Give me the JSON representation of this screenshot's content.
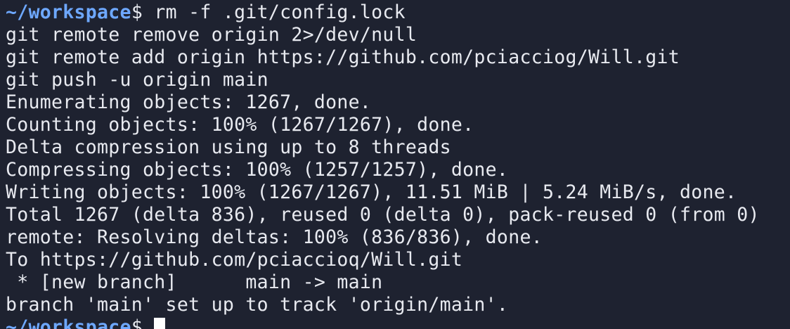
{
  "window": {
    "app": "terminal"
  },
  "prompt": {
    "path": "~/workspace",
    "symbol": "$"
  },
  "command_line": {
    "command": "rm -f .git/config.lock"
  },
  "output_lines": [
    "git remote remove origin 2>/dev/null",
    "git remote add origin https://github.com/pciacciog/Will.git",
    "git push -u origin main",
    "Enumerating objects: 1267, done.",
    "Counting objects: 100% (1267/1267), done.",
    "Delta compression using up to 8 threads",
    "Compressing objects: 100% (1257/1257), done.",
    "Writing objects: 100% (1267/1267), 11.51 MiB | 5.24 MiB/s, done.",
    "Total 1267 (delta 836), reused 0 (delta 0), pack-reused 0 (from 0)",
    "remote: Resolving deltas: 100% (836/836), done.",
    "To https://github.com/pciaccioq/Will.git",
    " * [new branch]      main -> main",
    "branch 'main' set up to track 'origin/main'."
  ],
  "last_prompt": {
    "path": "~/workspace",
    "symbol": "$"
  },
  "colors": {
    "background": "#1e2230",
    "text": "#e8eaf0",
    "prompt": "#6ea8ff",
    "cursor": "#ffffff"
  }
}
